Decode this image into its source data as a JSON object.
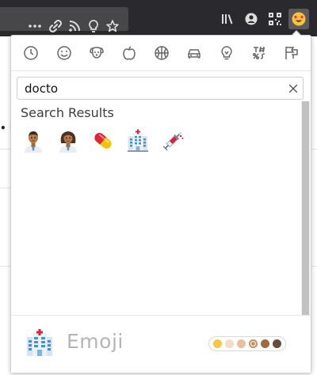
{
  "toolbar": {
    "icons": [
      "more-actions-icon",
      "link-icon",
      "rss-feed-icon",
      "lightbulb-icon",
      "bookmark-star-icon",
      "library-icon",
      "account-icon",
      "qr-code-icon",
      "emoji-extension-icon"
    ]
  },
  "page": {
    "fragment_text": "• F"
  },
  "panel": {
    "categories": [
      {
        "name": "recent",
        "icon": "clock-icon"
      },
      {
        "name": "smileys",
        "icon": "smiley-icon"
      },
      {
        "name": "animals",
        "icon": "dog-icon"
      },
      {
        "name": "food",
        "icon": "apple-icon"
      },
      {
        "name": "activities",
        "icon": "basketball-icon"
      },
      {
        "name": "travel",
        "icon": "car-icon"
      },
      {
        "name": "objects",
        "icon": "lightbulb-icon"
      },
      {
        "name": "symbols",
        "icon": "symbols-icon"
      },
      {
        "name": "flags",
        "icon": "flags-icon"
      }
    ],
    "search": {
      "value": "docto",
      "placeholder": ""
    },
    "results_title": "Search Results",
    "results": [
      {
        "name": "man-health-worker",
        "glyph": "👨‍⚕️"
      },
      {
        "name": "woman-health-worker",
        "glyph": "👩‍⚕️"
      },
      {
        "name": "pill",
        "glyph": "💊"
      },
      {
        "name": "hospital",
        "glyph": "🏥"
      },
      {
        "name": "syringe",
        "glyph": "💉"
      }
    ],
    "footer": {
      "title": "Emoji",
      "logo_icon": "hospital-icon",
      "skin_tones": [
        "#f8c63a",
        "#f6dcc4",
        "#e8c09a",
        "#c9915c",
        "#a06a3e",
        "#6b4a3a"
      ],
      "selected_skin_tone_index": 3
    }
  }
}
